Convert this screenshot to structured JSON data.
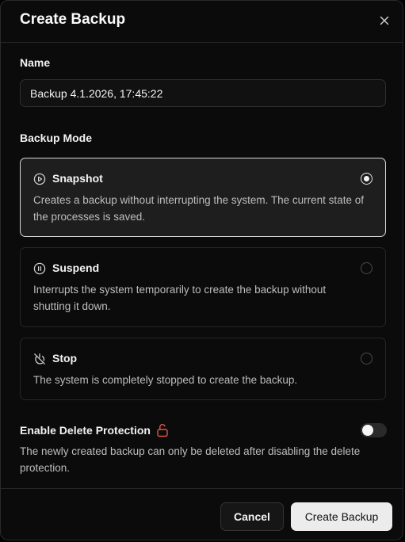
{
  "dialog": {
    "title": "Create Backup",
    "close_icon": "close-icon"
  },
  "name": {
    "label": "Name",
    "value": "Backup 4.1.2026, 17:45:22"
  },
  "backup_mode": {
    "label": "Backup Mode",
    "selected": "snapshot",
    "options": [
      {
        "id": "snapshot",
        "icon": "play-circle-icon",
        "title": "Snapshot",
        "description": "Creates a backup without interrupting the system. The current state of the processes is saved.",
        "selected": true
      },
      {
        "id": "suspend",
        "icon": "pause-circle-icon",
        "title": "Suspend",
        "description": "Interrupts the system temporarily to create the backup without shutting it down.",
        "selected": false
      },
      {
        "id": "stop",
        "icon": "power-off-icon",
        "title": "Stop",
        "description": "The system is completely stopped to create the backup.",
        "selected": false
      }
    ]
  },
  "delete_protection": {
    "label": "Enable Delete Protection",
    "icon": "unlock-icon",
    "enabled": false,
    "description": "The newly created backup can only be deleted after disabling the delete protection.",
    "icon_color": "#e5534b"
  },
  "footer": {
    "cancel_label": "Cancel",
    "create_label": "Create Backup"
  }
}
